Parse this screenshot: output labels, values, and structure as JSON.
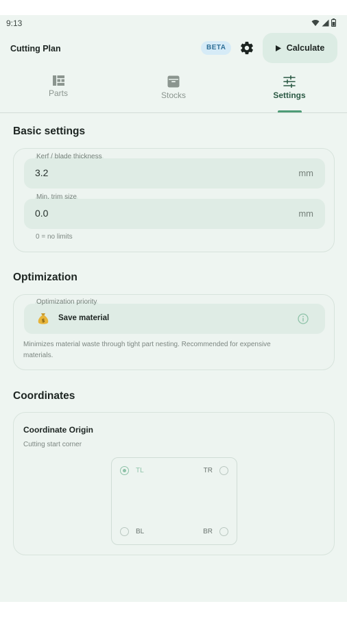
{
  "status": {
    "time": "9:13"
  },
  "appbar": {
    "title": "Cutting Plan",
    "beta": "BETA",
    "calculate_label": "Calculate"
  },
  "tabs": [
    {
      "label": "Parts",
      "icon": "parts-grid-icon"
    },
    {
      "label": "Stocks",
      "icon": "archive-box-icon"
    },
    {
      "label": "Settings",
      "icon": "sliders-icon",
      "active": true
    }
  ],
  "basic": {
    "title": "Basic settings",
    "kerf": {
      "label": "Kerf / blade thickness",
      "value": "3.2",
      "unit": "mm"
    },
    "trim": {
      "label": "Min. trim size",
      "value": "0.0",
      "unit": "mm"
    },
    "helper": "0 = no limits"
  },
  "optimization": {
    "title": "Optimization",
    "priority_label": "Optimization priority",
    "priority_value": "Save material",
    "priority_emoji": "money-bag-icon",
    "description_line1": "Minimizes material waste through tight part nesting. Recommended for expensive",
    "description_line2": "materials."
  },
  "coordinates": {
    "title": "Coordinates",
    "origin_title": "Coordinate Origin",
    "origin_sub": "Cutting start corner",
    "corners": {
      "tl": "TL",
      "tr": "TR",
      "bl": "BL",
      "br": "BR"
    },
    "selected": "TL"
  },
  "colors": {
    "accent": "#4e9b76",
    "background": "#eef5f1",
    "badge_bg": "#d6ebf7"
  }
}
